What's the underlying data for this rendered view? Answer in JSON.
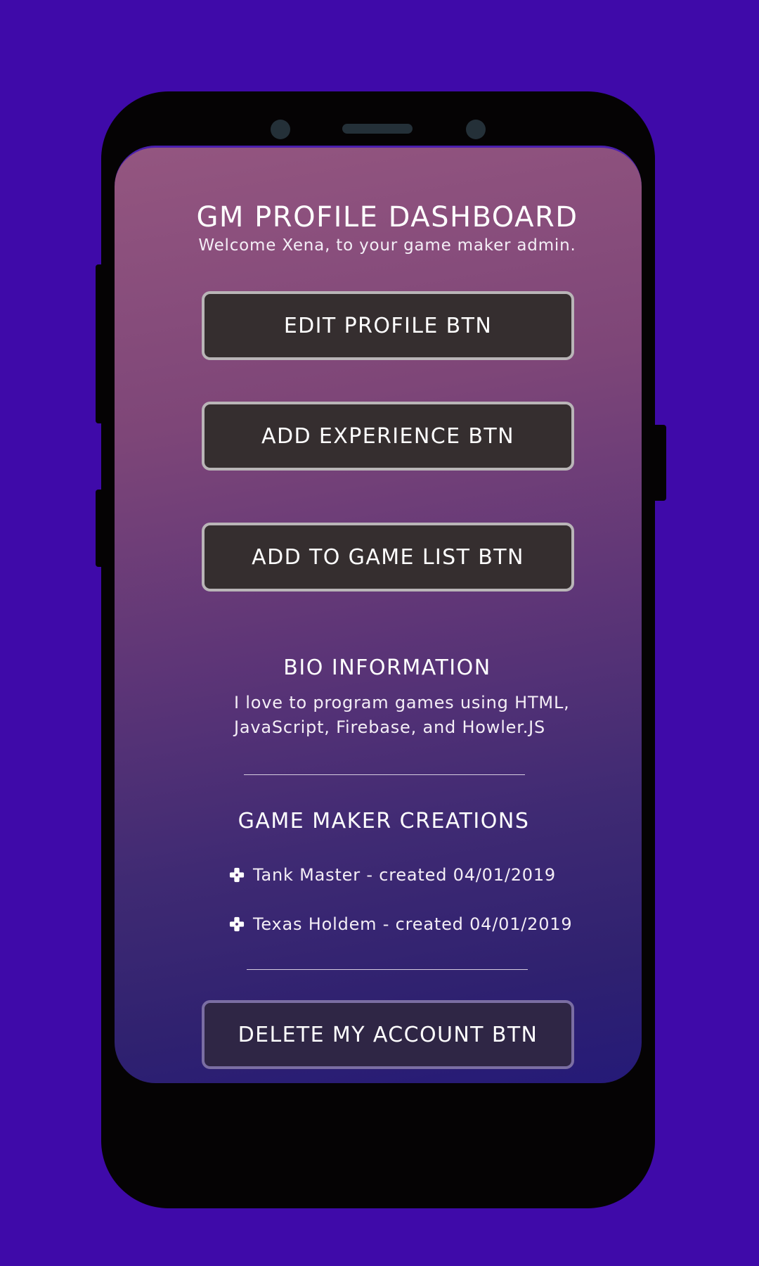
{
  "colors": {
    "background": "#3f0aa9",
    "phone_body": "#050304",
    "button_fill": "#352e2f",
    "button_border": "#b9b5b7",
    "delete_fill": "#2f2645",
    "delete_border": "#7b6ea3",
    "gradient_top": "#945680",
    "gradient_bottom": "#251a78"
  },
  "header": {
    "title": "GM PROFILE DASHBOARD",
    "subtitle": "Welcome Xena, to your game maker admin."
  },
  "actions": {
    "edit_profile": "EDIT PROFILE BTN",
    "add_experience": "ADD EXPERIENCE BTN",
    "add_to_game_list": "ADD TO GAME LIST BTN",
    "delete_account": "DELETE MY ACCOUNT BTN"
  },
  "bio": {
    "title": "BIO INFORMATION",
    "text": "I love to program games using HTML, JavaScript, Firebase, and Howler.JS"
  },
  "creations": {
    "title": "GAME MAKER CREATIONS",
    "icon": "gamepad-icon",
    "items": [
      {
        "label": "Tank Master - created 04/01/2019"
      },
      {
        "label": "Texas Holdem - created 04/01/2019"
      }
    ]
  }
}
